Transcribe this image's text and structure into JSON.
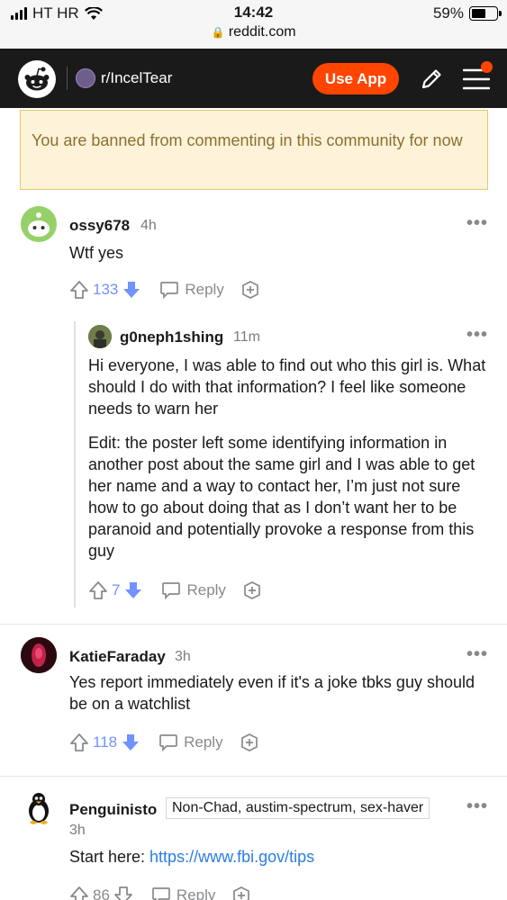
{
  "status_bar": {
    "carrier": "HT HR",
    "time": "14:42",
    "url": "reddit.com",
    "battery": "59%",
    "battery_level": 0.59
  },
  "header": {
    "subreddit": "r/IncelTear",
    "use_app_label": "Use App",
    "accent_color": "#ff4500"
  },
  "banner": {
    "text": "You are banned from commenting in this community for now"
  },
  "comments": [
    {
      "username": "ossy678",
      "age": "4h",
      "body": "Wtf yes",
      "score": "133",
      "reply_label": "Reply"
    },
    {
      "username": "g0neph1shing",
      "age": "11m",
      "body_paragraphs": [
        "Hi everyone, I was able to find out who this girl is. What should I do with that information? I feel like someone needs to warn her",
        "Edit: the poster left some identifying information in another post about the same girl and I was able to get her name and a way to contact her, I’m just not sure how to go about doing that as I don’t want her to be paranoid and potentially provoke a response from this guy"
      ],
      "score": "7",
      "reply_label": "Reply"
    },
    {
      "username": "KatieFaraday",
      "age": "3h",
      "body": "Yes report immediately even if it's a joke tbks guy should be on a watchlist",
      "score": "118",
      "reply_label": "Reply"
    },
    {
      "username": "Penguinisto",
      "flair": "Non-Chad, austim-spectrum, sex-haver",
      "age": "3h",
      "body_prefix": "Start here: ",
      "link": "https://www.fbi.gov/tips",
      "score": "86",
      "reply_label": "Reply"
    }
  ],
  "more_label": "•••"
}
